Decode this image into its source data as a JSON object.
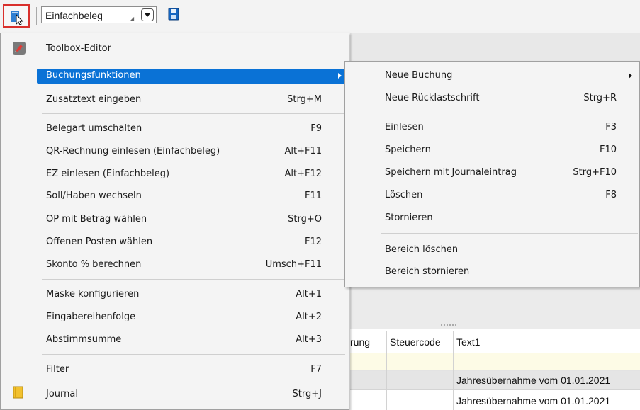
{
  "toolbar": {
    "belegart_value": "Einfachbeleg",
    "toolbox_button_icon": "toolbox-select-icon",
    "save_icon": "floppy-disk-icon"
  },
  "grid": {
    "columns": [
      "rung",
      "Steuercode",
      "Text1"
    ],
    "rows": [
      {
        "text1": ""
      },
      {
        "text1": "Jahresübernahme vom 01.01.2021"
      },
      {
        "text1": "Jahresübernahme vom 01.01.2021"
      }
    ]
  },
  "menu": {
    "items": [
      {
        "label": "Toolbox-Editor",
        "shortcut": "",
        "icon": "toolbox-editor-icon"
      },
      {
        "label": "Buchungsfunktionen",
        "shortcut": "",
        "submenu": true
      },
      {
        "label": "Zusatztext eingeben",
        "shortcut": "Strg+M"
      },
      {
        "label": "Belegart umschalten",
        "shortcut": "F9"
      },
      {
        "label": "QR-Rechnung einlesen (Einfachbeleg)",
        "shortcut": "Alt+F11"
      },
      {
        "label": "EZ einlesen (Einfachbeleg)",
        "shortcut": "Alt+F12"
      },
      {
        "label": "Soll/Haben wechseln",
        "shortcut": "F11"
      },
      {
        "label": "OP mit Betrag wählen",
        "shortcut": "Strg+O"
      },
      {
        "label": "Offenen Posten wählen",
        "shortcut": "F12"
      },
      {
        "label": "Skonto % berechnen",
        "shortcut": "Umsch+F11"
      },
      {
        "label": "Maske konfigurieren",
        "shortcut": "Alt+1"
      },
      {
        "label": "Eingabereihenfolge",
        "shortcut": "Alt+2"
      },
      {
        "label": "Abstimmsumme",
        "shortcut": "Alt+3"
      },
      {
        "label": "Filter",
        "shortcut": "F7"
      },
      {
        "label": "Journal",
        "shortcut": "Strg+J",
        "icon": "journal-icon"
      }
    ]
  },
  "submenu": {
    "items": [
      {
        "label": "Neue Buchung",
        "shortcut": "",
        "submenu": true
      },
      {
        "label": "Neue Rücklastschrift",
        "shortcut": "Strg+R"
      },
      {
        "label": "Einlesen",
        "shortcut": "F3"
      },
      {
        "label": "Speichern",
        "shortcut": "F10"
      },
      {
        "label": "Speichern mit Journaleintrag",
        "shortcut": "Strg+F10"
      },
      {
        "label": "Löschen",
        "shortcut": "F8"
      },
      {
        "label": "Stornieren",
        "shortcut": ""
      },
      {
        "label": "Bereich löschen",
        "shortcut": ""
      },
      {
        "label": "Bereich stornieren",
        "shortcut": ""
      }
    ]
  },
  "colors": {
    "highlight": "#0a72d6",
    "focus_border": "#d9302c",
    "menu_bg": "#f4f4f4"
  }
}
